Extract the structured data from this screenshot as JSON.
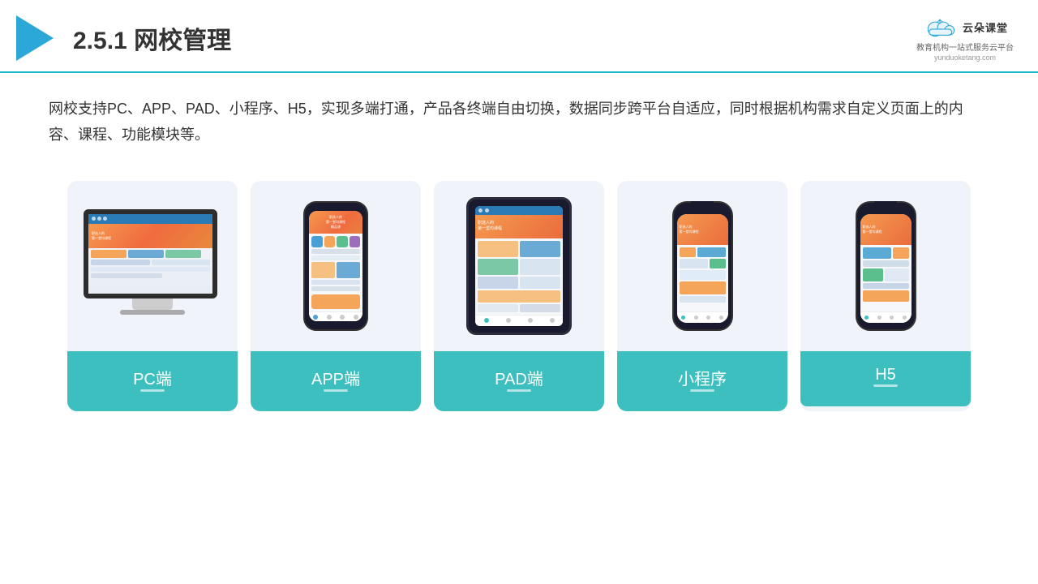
{
  "header": {
    "section": "2.5.1",
    "title": "网校管理",
    "brand": {
      "name": "云朵课堂",
      "url": "yunduoketang.com",
      "tagline": "教育机构一站式服务云平台"
    }
  },
  "description": {
    "text": "网校支持PC、APP、PAD、小程序、H5，实现多端打通，产品各终端自由切换，数据同步跨平台自适应，同时根据机构需求自定义页面上的内容、课程、功能模块等。"
  },
  "cards": [
    {
      "id": "pc",
      "label": "PC端",
      "device": "pc"
    },
    {
      "id": "app",
      "label": "APP端",
      "device": "phone"
    },
    {
      "id": "pad",
      "label": "PAD端",
      "device": "pad"
    },
    {
      "id": "mini",
      "label": "小程序",
      "device": "mini"
    },
    {
      "id": "h5",
      "label": "H5",
      "device": "h5"
    }
  ],
  "colors": {
    "accent": "#3dbfbf",
    "headerBorder": "#1ab8c8",
    "cardBg": "#f0f4fa",
    "titleColor": "#333333"
  }
}
